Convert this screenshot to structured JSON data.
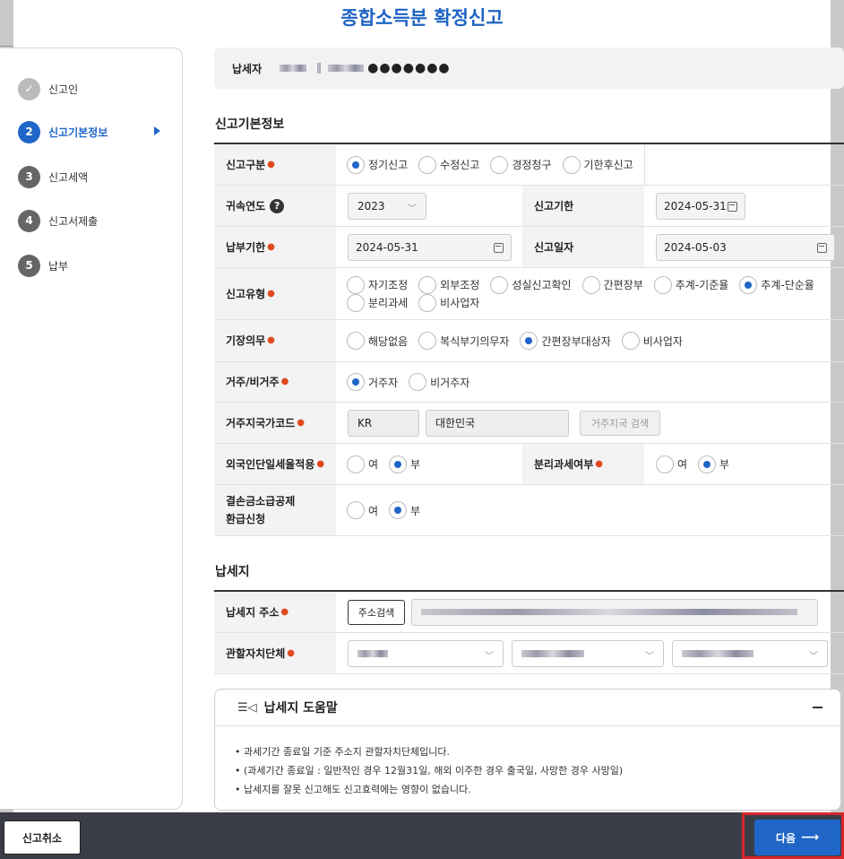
{
  "page_title": "종합소득분 확정신고",
  "steps": [
    {
      "num": "✓",
      "label": "신고인"
    },
    {
      "num": "2",
      "label": "신고기본정보"
    },
    {
      "num": "3",
      "label": "신고세액"
    },
    {
      "num": "4",
      "label": "신고서제출"
    },
    {
      "num": "5",
      "label": "납부"
    }
  ],
  "taxpayer": {
    "label": "납세자",
    "masked": "●●●●●●●"
  },
  "basic": {
    "title": "신고기본정보",
    "report_type": {
      "label": "신고구분",
      "options": [
        "정기신고",
        "수정신고",
        "경정청구",
        "기한후신고"
      ],
      "selected": "정기신고"
    },
    "year": {
      "label": "귀속연도",
      "value": "2023",
      "help": "?"
    },
    "due": {
      "label": "신고기한",
      "value": "2024-05-31"
    },
    "pay_due": {
      "label": "납부기한",
      "value": "2024-05-31"
    },
    "report_date": {
      "label": "신고일자",
      "value": "2024-05-03"
    },
    "kind": {
      "label": "신고유형",
      "options": [
        "자기조정",
        "외부조정",
        "성실신고확인",
        "간편장부",
        "추계-기준율",
        "추계-단순율",
        "분리과세",
        "비사업자"
      ],
      "selected": "추계-단순율"
    },
    "bookkeeping": {
      "label": "기장의무",
      "options": [
        "해당없음",
        "복식부기의무자",
        "간편장부대상자",
        "비사업자"
      ],
      "selected": "간편장부대상자"
    },
    "residency": {
      "label": "거주/비거주",
      "options": [
        "거주자",
        "비거주자"
      ],
      "selected": "거주자"
    },
    "country": {
      "label": "거주지국가코드",
      "code": "KR",
      "name": "대한민국",
      "search": "거주지국 검색"
    },
    "foreign_flat": {
      "label": "외국인단일세율적용",
      "options": [
        "여",
        "부"
      ],
      "selected": "부"
    },
    "separate": {
      "label": "분리과세여부",
      "options": [
        "여",
        "부"
      ],
      "selected": "부"
    },
    "loss_refund": {
      "label1": "결손금소급공제",
      "label2": "환급신청",
      "options": [
        "여",
        "부"
      ],
      "selected": "부"
    }
  },
  "place": {
    "title": "납세지",
    "address_label": "납세지 주소",
    "address_button": "주소검색",
    "municipality_label": "관할자치단체"
  },
  "help": {
    "title": "납세지 도움말",
    "icon": "megaphone-icon",
    "items": [
      "• 과세기간 종료일 기준 주소지 관할자치단체입니다.",
      "• (과세기간 종료일 : 일반적인 경우 12월31일, 해외 이주한 경우 출국일, 사망한 경우 사망일)",
      "• 납세지를 잘못 신고해도 신고효력에는 영향이 없습니다."
    ]
  },
  "footer": {
    "cancel": "신고취소",
    "next": "다음"
  }
}
